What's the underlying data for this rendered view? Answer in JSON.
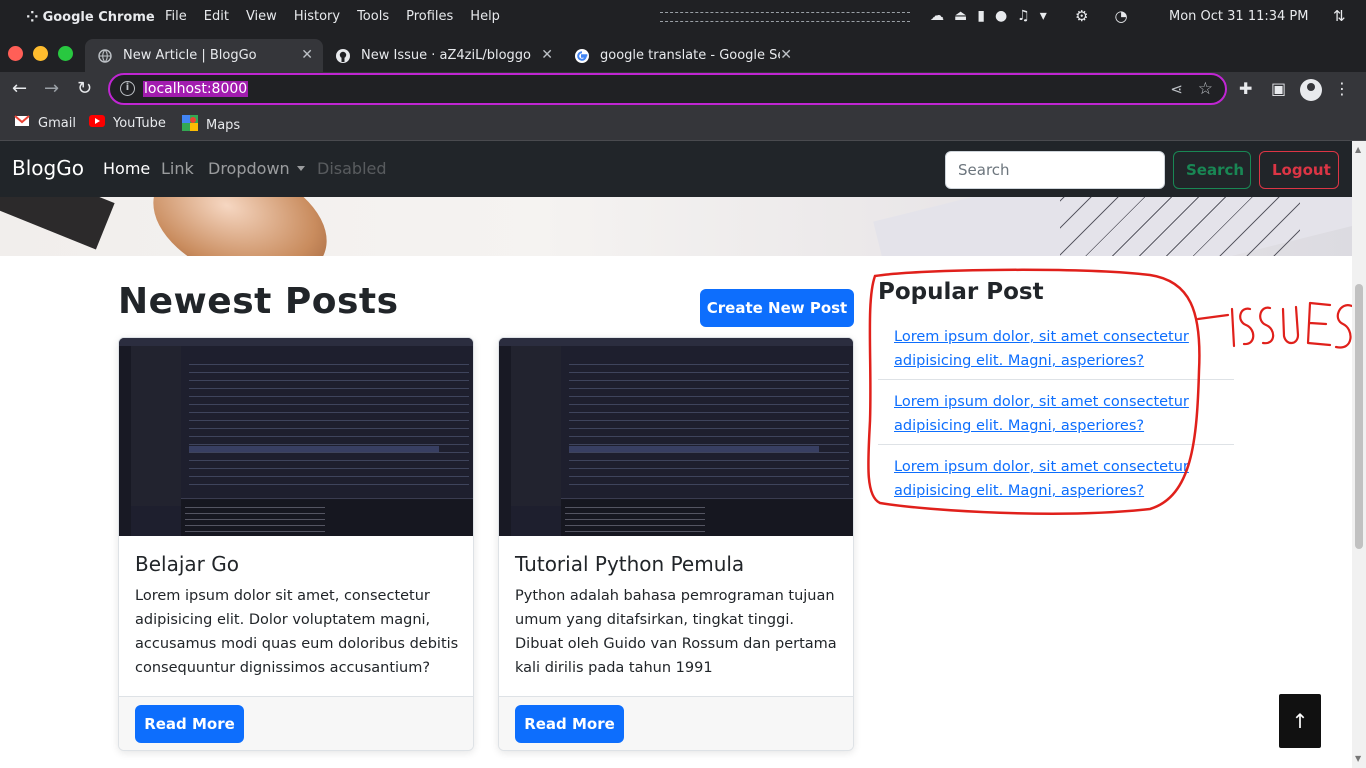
{
  "os": {
    "app_name": "Google Chrome",
    "menu": [
      "File",
      "Edit",
      "View",
      "History",
      "Tools",
      "Profiles",
      "Help"
    ],
    "clock": "Mon  Oct  31 11:34 PM"
  },
  "browser": {
    "tabs": [
      {
        "title": "New Article | BlogGo",
        "active": true
      },
      {
        "title": "New Issue · aZ4ziL/bloggo",
        "active": false
      },
      {
        "title": "google translate - Google Sea",
        "active": false
      }
    ],
    "url": "localhost:8000",
    "bookmarks": [
      {
        "label": "Gmail",
        "icon": "gmail-icon"
      },
      {
        "label": "YouTube",
        "icon": "youtube-icon"
      },
      {
        "label": "Maps",
        "icon": "maps-icon"
      }
    ]
  },
  "navbar": {
    "brand": "BlogGo",
    "links": [
      {
        "label": "Home",
        "state": "active"
      },
      {
        "label": "Link",
        "state": "normal"
      },
      {
        "label": "Dropdown",
        "state": "dropdown"
      },
      {
        "label": "Disabled",
        "state": "disabled"
      }
    ],
    "search_placeholder": "Search",
    "search_button": "Search",
    "logout_button": "Logout"
  },
  "main": {
    "heading": "Newest Posts",
    "create_button": "Create New Post",
    "posts": [
      {
        "title": "Belajar Go",
        "text": "Lorem ipsum dolor sit amet, consectetur adipisicing elit. Dolor voluptatem magni, accusamus modi quas eum doloribus debitis consequuntur dignissimos accusantium?",
        "button": "Read More"
      },
      {
        "title": "Tutorial Python Pemula",
        "text": "Python adalah bahasa pemrograman tujuan umum yang ditafsirkan, tingkat tinggi. Dibuat oleh Guido van Rossum dan pertama kali dirilis pada tahun 1991",
        "button": "Read More"
      }
    ]
  },
  "sidebar": {
    "heading": "Popular Post",
    "links": [
      "Lorem ipsum dolor, sit amet consectetur adipisicing elit. Magni, asperiores?",
      "Lorem ipsum dolor, sit amet consectetur adipisicing elit. Magni, asperiores?",
      "Lorem ipsum dolor, sit amet consectetur adipisicing elit. Magni, asperiores?"
    ]
  },
  "annotation": {
    "label": "ISSUES",
    "color": "#e0201b"
  },
  "colors": {
    "primary": "#0d6efd",
    "success": "#198754",
    "danger": "#dc3545",
    "navbar": "#212529",
    "omnibox_highlight": "#c026d3"
  }
}
